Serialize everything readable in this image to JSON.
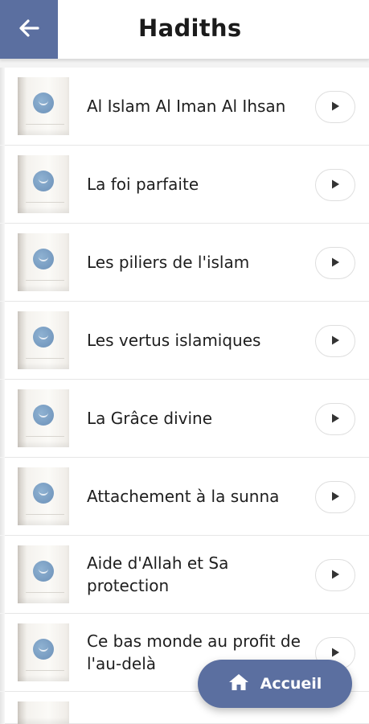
{
  "header": {
    "title": "Hadiths",
    "back_icon": "arrow-left-icon",
    "accent_color": "#5b6fa0"
  },
  "items": [
    {
      "title": "Al Islam Al Iman Al Ihsan"
    },
    {
      "title": "La foi parfaite"
    },
    {
      "title": "Les piliers de l'islam"
    },
    {
      "title": "Les vertus islamiques"
    },
    {
      "title": "La Grâce divine"
    },
    {
      "title": "Attachement à la sunna"
    },
    {
      "title": "Aide d'Allah et Sa protection"
    },
    {
      "title": "Ce bas monde au profit de l'au-delà"
    }
  ],
  "fab": {
    "label": "Accueil",
    "icon": "home-icon"
  }
}
